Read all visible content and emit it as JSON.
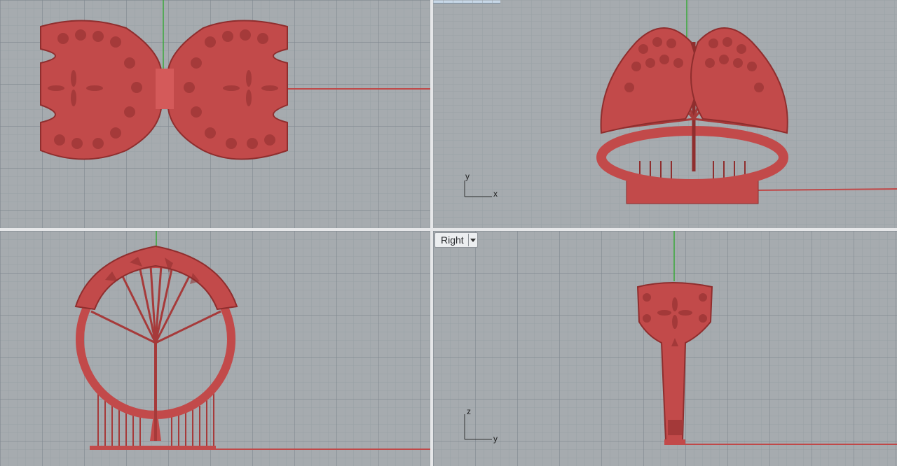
{
  "viewports": {
    "top": {
      "label": ""
    },
    "perspective": {
      "label": ""
    },
    "front": {
      "label": ""
    },
    "right": {
      "label": "Right"
    }
  },
  "axes": {
    "perspective": {
      "y": "y",
      "x": "x"
    },
    "right": {
      "z": "z",
      "y": "y"
    }
  },
  "colors": {
    "viewport_bg": "#a6abaf",
    "grid_minor": "#98a0a6",
    "grid_major": "#7f888f",
    "axis_x": "#c04848",
    "axis_y": "#3aa83a",
    "model": "#c24a4a",
    "model_dark": "#8f2e2e"
  },
  "icons": {
    "viewport_menu": "chevron-down-icon"
  }
}
